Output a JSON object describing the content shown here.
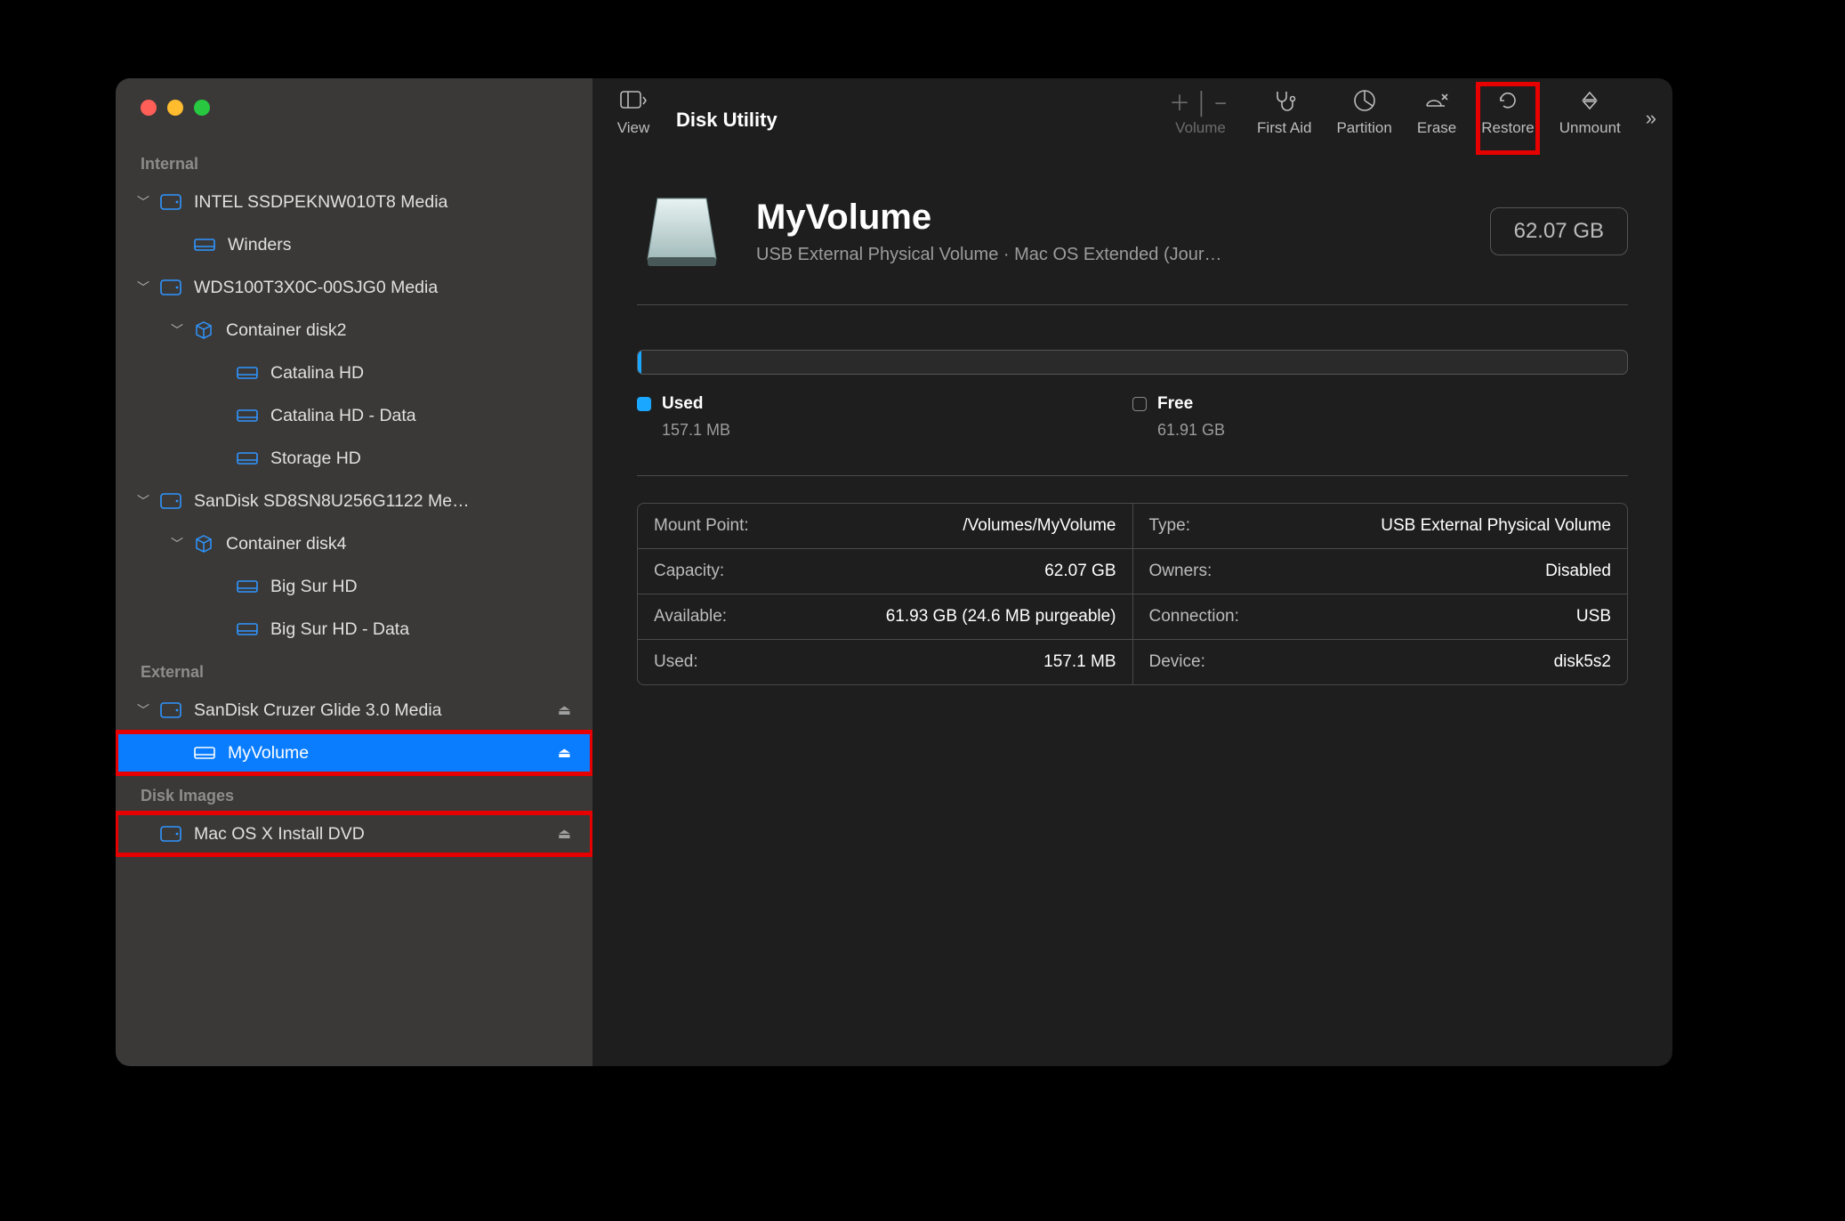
{
  "app_title": "Disk Utility",
  "toolbar": {
    "view": "View",
    "volume": "Volume",
    "first_aid": "First Aid",
    "partition": "Partition",
    "erase": "Erase",
    "restore": "Restore",
    "unmount": "Unmount"
  },
  "sidebar": {
    "sections": {
      "internal": "Internal",
      "external": "External",
      "disk_images": "Disk Images"
    },
    "internal": [
      {
        "label": "INTEL SSDPEKNW010T8 Media",
        "icon": "disk",
        "indent": 0,
        "disclosure": true
      },
      {
        "label": "Winders",
        "icon": "volume",
        "indent": 1
      },
      {
        "label": "WDS100T3X0C-00SJG0 Media",
        "icon": "disk",
        "indent": 0,
        "disclosure": true
      },
      {
        "label": "Container disk2",
        "icon": "container",
        "indent": 1,
        "disclosure": true
      },
      {
        "label": "Catalina HD",
        "icon": "volume",
        "indent": 2
      },
      {
        "label": "Catalina HD - Data",
        "icon": "volume",
        "indent": 2
      },
      {
        "label": "Storage HD",
        "icon": "volume",
        "indent": 2
      },
      {
        "label": "SanDisk SD8SN8U256G1122 Me…",
        "icon": "disk",
        "indent": 0,
        "disclosure": true
      },
      {
        "label": "Container disk4",
        "icon": "container",
        "indent": 1,
        "disclosure": true
      },
      {
        "label": "Big Sur HD",
        "icon": "volume",
        "indent": 2
      },
      {
        "label": "Big Sur HD - Data",
        "icon": "volume",
        "indent": 2
      }
    ],
    "external": [
      {
        "label": "SanDisk Cruzer Glide 3.0 Media",
        "icon": "disk",
        "indent": 0,
        "disclosure": true,
        "eject": true
      },
      {
        "label": "MyVolume",
        "icon": "volume",
        "indent": 1,
        "selected": true,
        "eject": true
      }
    ],
    "disk_images": [
      {
        "label": "Mac OS X Install DVD",
        "icon": "disk",
        "indent": 0,
        "eject": true
      }
    ]
  },
  "volume": {
    "name": "MyVolume",
    "subtitle": "USB External Physical Volume · Mac OS Extended (Jour…",
    "size": "62.07 GB"
  },
  "usage": {
    "used_label": "Used",
    "used_value": "157.1 MB",
    "free_label": "Free",
    "free_value": "61.91 GB"
  },
  "info": {
    "left": [
      {
        "k": "Mount Point:",
        "v": "/Volumes/MyVolume"
      },
      {
        "k": "Capacity:",
        "v": "62.07 GB"
      },
      {
        "k": "Available:",
        "v": "61.93 GB (24.6 MB purgeable)"
      },
      {
        "k": "Used:",
        "v": "157.1 MB"
      }
    ],
    "right": [
      {
        "k": "Type:",
        "v": "USB External Physical Volume"
      },
      {
        "k": "Owners:",
        "v": "Disabled"
      },
      {
        "k": "Connection:",
        "v": "USB"
      },
      {
        "k": "Device:",
        "v": "disk5s2"
      }
    ]
  },
  "highlights": {
    "restore": true,
    "myvolume_row": true,
    "dvd_row": true
  }
}
